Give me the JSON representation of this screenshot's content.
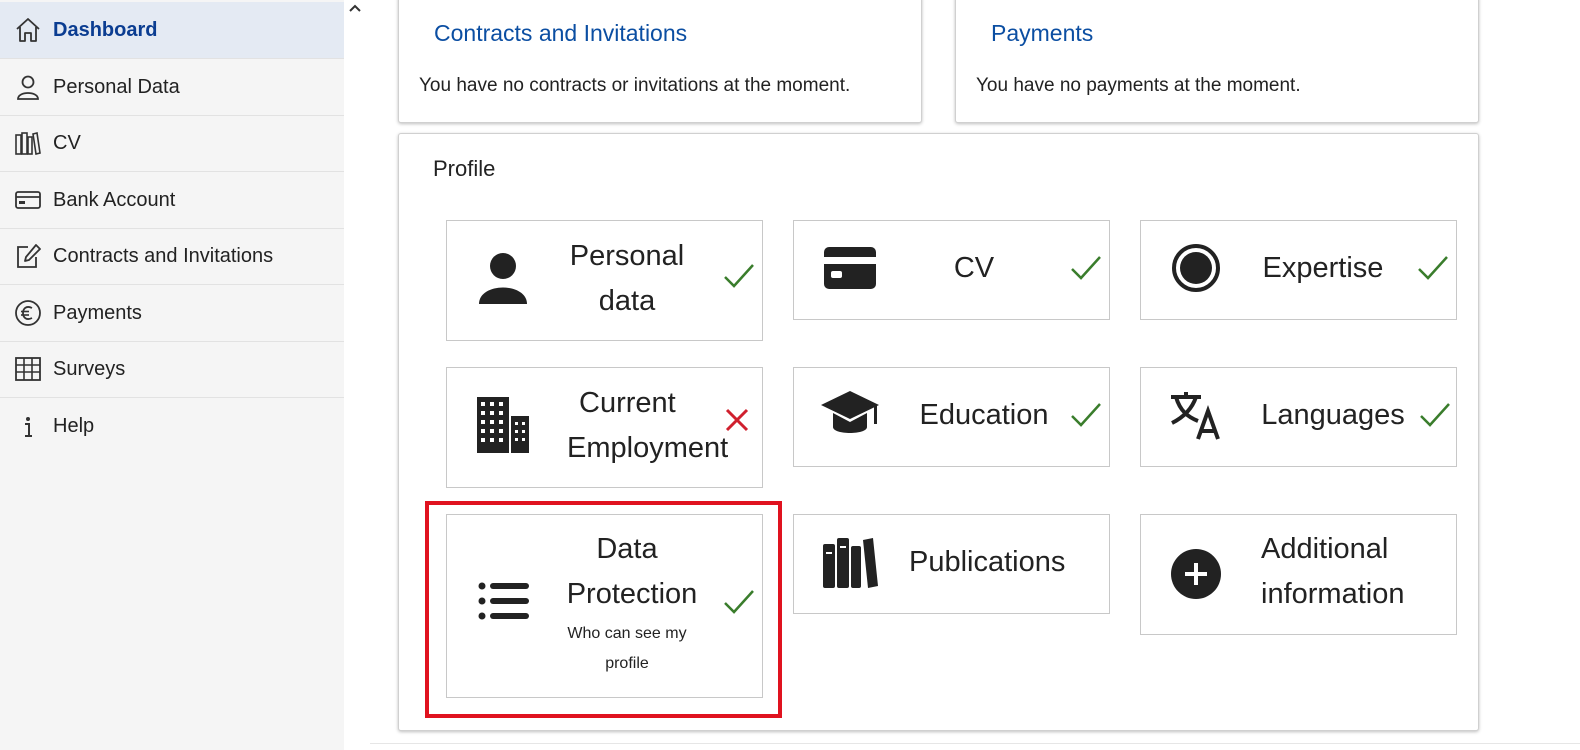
{
  "sidebar": {
    "items": [
      {
        "label": "Dashboard",
        "icon": "home-icon"
      },
      {
        "label": "Personal Data",
        "icon": "person-icon"
      },
      {
        "label": "CV",
        "icon": "books-icon"
      },
      {
        "label": "Bank Account",
        "icon": "card-icon"
      },
      {
        "label": "Contracts and Invitations",
        "icon": "edit-icon"
      },
      {
        "label": "Payments",
        "icon": "euro-icon"
      },
      {
        "label": "Surveys",
        "icon": "grid-icon"
      },
      {
        "label": "Help",
        "icon": "info-icon"
      }
    ],
    "collapse_glyph": "^"
  },
  "contracts": {
    "title": "Contracts and Invitations",
    "text": "You have no contracts or invitations at the moment."
  },
  "payments": {
    "title": "Payments",
    "text": "You have no payments at the moment."
  },
  "profile": {
    "title": "Profile",
    "tiles": [
      {
        "line1": "Personal",
        "line2": "data",
        "status": "complete",
        "icon": "person-filled-icon"
      },
      {
        "line1": "CV",
        "status": "complete",
        "icon": "credit-card-icon"
      },
      {
        "line1": "Expertise",
        "status": "complete",
        "icon": "radio-target-icon"
      },
      {
        "line1": "Current",
        "line2": "Employment",
        "status": "incomplete",
        "icon": "building-icon"
      },
      {
        "line1": "Education",
        "status": "complete",
        "icon": "graduation-cap-icon"
      },
      {
        "line1": "Languages",
        "status": "complete",
        "icon": "translate-icon"
      },
      {
        "line1": "Data",
        "line2": "Protection",
        "sub1": "Who can see my",
        "sub2": "profile",
        "status": "complete",
        "icon": "list-icon"
      },
      {
        "line1": "Publications",
        "icon": "books-filled-icon"
      },
      {
        "line1": "Additional",
        "line2": "information",
        "icon": "plus-circle-icon"
      }
    ]
  },
  "colors": {
    "accent": "#0b4ea2",
    "check": "#3a7d2c",
    "cross": "#d0202e",
    "highlight": "#e0121f"
  }
}
